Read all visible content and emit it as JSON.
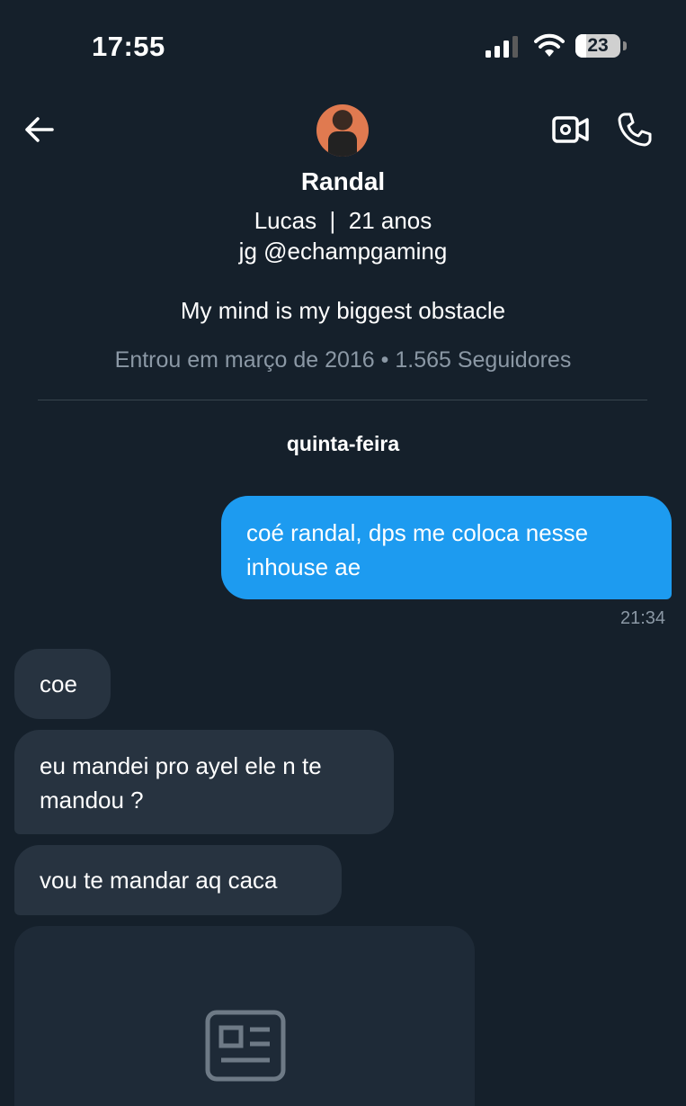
{
  "status_bar": {
    "time": "17:55",
    "battery": "23"
  },
  "header": {
    "name": "Randal",
    "bio_line1": "Lucas  |  21 anos",
    "bio_line2": "jg @echampgaming",
    "bio_line3": "My mind is my biggest obstacle",
    "joined": "Entrou em março de 2016 • 1.565 Seguidores"
  },
  "conversation": {
    "day_label": "quinta-feira",
    "messages": [
      {
        "direction": "out",
        "text": "coé randal, dps me coloca nesse inhouse ae",
        "time": "21:34"
      },
      {
        "direction": "in",
        "text": "coe"
      },
      {
        "direction": "in",
        "text": "eu mandei pro ayel ele n te mandou ?"
      },
      {
        "direction": "in",
        "text": "vou te mandar aq caca"
      }
    ]
  },
  "icons": {
    "back": "arrow-left-icon",
    "video": "video-camera-icon",
    "phone": "phone-icon",
    "card": "news-article-icon"
  },
  "colors": {
    "background": "#15202b",
    "outgoing_bubble": "#1d9bf0",
    "incoming_bubble": "#273340",
    "secondary_text": "#8b98a5"
  }
}
